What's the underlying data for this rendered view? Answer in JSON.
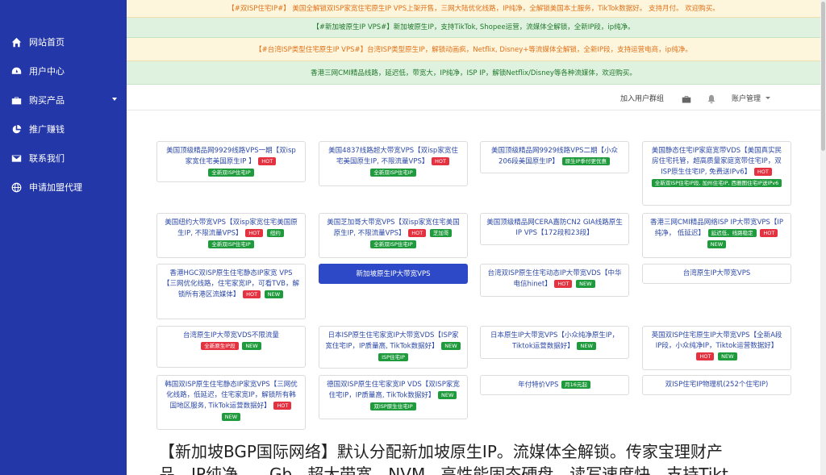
{
  "sidebar": {
    "items": [
      {
        "label": "网站首页",
        "icon": "home-icon"
      },
      {
        "label": "用户中心",
        "icon": "dashboard-icon"
      },
      {
        "label": "购买产品",
        "icon": "briefcase-icon"
      },
      {
        "label": "推广赚钱",
        "icon": "pie-chart-icon"
      },
      {
        "label": "联系我们",
        "icon": "envelope-icon"
      },
      {
        "label": "申请加盟代理",
        "icon": "globe-icon"
      }
    ]
  },
  "notices": [
    "【#双ISP住宅IP#】 美国全解锁双ISP家宽住宅原生IP VPS上架开售，三网大陆优化线路，IP纯净，全解锁美国本土服务，TikTok数据好。 支持月付。 欢迎购买。",
    "【#新加坡原生IP VPS#】新加坡原生IP，支持TikTok, Shopee运营，流媒体全解锁，全新IP段，ip纯净。",
    "【#台湾ISP类型住宅原生IP VPS#】台湾ISP类型原生IP，解锁动画疯，Netflix, Disney+等流媒体全解锁，全新IP段，支持运营电商，ip纯净。",
    "香港三网CMI精品线路，延迟低，带宽大，IP纯净，ISP IP，解锁Netflix/Disney等各种流媒体，欢迎购买。"
  ],
  "topbar": {
    "join_group": "加入用户群组",
    "account": "账户管理"
  },
  "products": [
    {
      "title": "美国顶级精品网9929线路VPS一期【双isp家宽住宅美国原生IP 】",
      "badges": [
        {
          "text": "HOT",
          "color": "red"
        },
        {
          "text": "全新双ISP住宅IP",
          "color": "green"
        }
      ]
    },
    {
      "title": "美国4837线路超大带宽VPS【双isp家宽住宅美国原生IP, 不限流量VPS】",
      "badges": [
        {
          "text": "HOT",
          "color": "red"
        },
        {
          "text": "全新双ISP住宅IP",
          "color": "green"
        }
      ]
    },
    {
      "title": "美国顶级精品网9929线路VPS二期【小众206段美国原生IP】",
      "badges": [
        {
          "text": "原生IP季付更优惠",
          "color": "green"
        }
      ]
    },
    {
      "title": "美国静态住宅IP家庭宽带VDS【美国真实民房住宅托管，超高质量家庭宽带住宅IP，双ISP原生住宅IP, 免费送IPv6】",
      "badges": [
        {
          "text": "HOT",
          "color": "red"
        },
        {
          "text": "全新双ISP住宅IP段, 加州住宅IP, 西雅图住宅IP送IPv6",
          "color": "green"
        }
      ]
    },
    {
      "title": "美国纽约大带宽VPS【双isp家宽住宅美国原生IP, 不限流量VPS】",
      "badges": [
        {
          "text": "HOT",
          "color": "red"
        },
        {
          "text": "纽约",
          "color": "green"
        },
        {
          "text": "全新双ISP住宅IP",
          "color": "green"
        }
      ]
    },
    {
      "title": "美国芝加哥大带宽VPS【双isp家宽住宅美国原生IP, 不限流量VPS】",
      "badges": [
        {
          "text": "HOT",
          "color": "red"
        },
        {
          "text": "芝加哥",
          "color": "green"
        },
        {
          "text": "全新双ISP住宅IP",
          "color": "green"
        }
      ]
    },
    {
      "title": "美国顶级精品网CERA嘉防CN2 GIA线路原生IP VPS【172段和23段】",
      "badges": []
    },
    {
      "title": "香港三网CMI精品网络ISP IP大带宽VPS【IP纯净， 低延迟】",
      "badges": [
        {
          "text": "延迟低，线路稳定",
          "color": "green"
        },
        {
          "text": "HOT",
          "color": "red"
        },
        {
          "text": "NEW",
          "color": "green"
        }
      ]
    },
    {
      "title": "香港HGC双ISP原生住宅静态IP家宽 VPS【三网优化线路，住宅家宽IP，可看TVB，解锁所有港区流媒体】",
      "badges": [
        {
          "text": "HOT",
          "color": "red"
        },
        {
          "text": "NEW",
          "color": "green"
        }
      ]
    },
    {
      "title": "新加坡原生IP大带宽VPS",
      "badges": [],
      "active": true
    },
    {
      "title": "台湾双ISP原生住宅动态IP大带宽VDS【中华电信hinet】",
      "badges": [
        {
          "text": "HOT",
          "color": "red"
        },
        {
          "text": "NEW",
          "color": "green"
        }
      ]
    },
    {
      "title": "台湾原生IP大带宽VPS",
      "badges": []
    },
    {
      "title": "台湾原生IP大带宽VDS不限流量",
      "badges": [
        {
          "text": "全新原生IP段",
          "color": "red"
        },
        {
          "text": "NEW",
          "color": "green"
        }
      ]
    },
    {
      "title": "日本ISP原生住宅家宽IP大带宽VDS【ISP家宽住宅IP，IP质量高, TikTok数据好】",
      "badges": [
        {
          "text": "NEW",
          "color": "green"
        },
        {
          "text": "ISP住宅IP",
          "color": "green"
        }
      ]
    },
    {
      "title": "日本原生IP大带宽VPS【小众纯净原生IP，Tiktok运营数据好】",
      "badges": [
        {
          "text": "NEW",
          "color": "green"
        }
      ]
    },
    {
      "title": "英国双ISP住宅原生IP大带宽VPS【全新A段IP段，小众纯净IP，Tiktok运营数据好】",
      "badges": [
        {
          "text": "HOT",
          "color": "red"
        },
        {
          "text": "NEW",
          "color": "green"
        }
      ]
    },
    {
      "title": "韩国双ISP原生住宅静态IP家宽VPS【三网优化线路，低延迟，住宅家宽IP，解锁所有韩国地区服务, TikTok运营数据好】",
      "badges": [
        {
          "text": "HOT",
          "color": "red"
        },
        {
          "text": "NEW",
          "color": "green"
        }
      ]
    },
    {
      "title": "德国双ISP原生住宅家宽IP VDS【双ISP家宽住宅IP，IP质量高, TikTok数据好】",
      "badges": [
        {
          "text": "NEW",
          "color": "green"
        },
        {
          "text": "双ISP原生住宅IP",
          "color": "green"
        }
      ]
    },
    {
      "title": "年付特价VPS",
      "badges": [
        {
          "text": "月16元起",
          "color": "green"
        }
      ]
    },
    {
      "title": "双ISP住宅IP物理机(252个住宅IP)",
      "badges": []
    }
  ],
  "bottom_text": {
    "line1": "【新加坡BGP国际网络】默认分配新加坡原生IP。流媒体全解锁。传家宝理财产",
    "line2": "品，IP纯净，...Gb...超大带宽，NVM...高性能固态硬盘，读写速度快，支持Tikt..."
  },
  "colors": {
    "sidebar": "#2437a8",
    "accent": "#2d49c8",
    "hot": "#e53240",
    "new": "#1f9b3d",
    "notice_yellow_bg": "#fdf6dc",
    "notice_green_bg": "#dff1df"
  }
}
